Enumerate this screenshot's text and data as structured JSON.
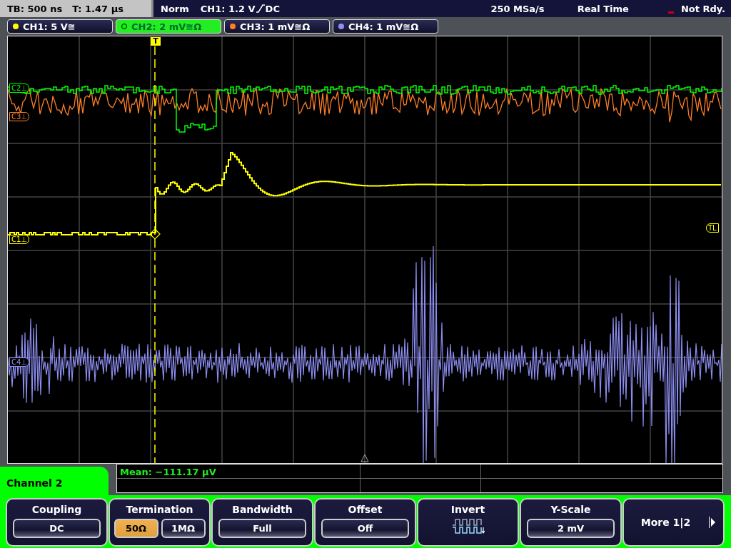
{
  "top_bar": {
    "timebase": "TB: 500 ns",
    "trigger_time": "T: 1.47 µs",
    "trigger_mode": "Norm",
    "trigger_level": "CH1: 1.2 V",
    "trigger_coupling": "DC",
    "sample_rate": "250 MSa/s",
    "acquisition": "Real Time",
    "status": "Not Rdy."
  },
  "channels": [
    {
      "label": "CH1: 5 V≅",
      "color": "#ffff00",
      "selected": false
    },
    {
      "label": "CH2: 2 mV≅Ω",
      "color": "#00ff00",
      "selected": true
    },
    {
      "label": "CH3: 1 mV≅Ω",
      "color": "#ff7f27",
      "selected": false
    },
    {
      "label": "CH4: 1 mV≅Ω",
      "color": "#9090f0",
      "selected": false
    }
  ],
  "plot": {
    "trigger_marker": "T",
    "markers": [
      {
        "label": "C2⊥",
        "color": "#00ff00",
        "kind": "left"
      },
      {
        "label": "C3⊥",
        "color": "#ff7f27",
        "kind": "left"
      },
      {
        "label": "C1⊥",
        "color": "#ffff00",
        "kind": "left"
      },
      {
        "label": "C4⊥",
        "color": "#9090f0",
        "kind": "left"
      },
      {
        "label": "TL",
        "color": "#ffff00",
        "kind": "right"
      }
    ]
  },
  "menu": {
    "title": "Channel 2",
    "measurement": "Mean: −111.17 µV",
    "softkeys": [
      {
        "kind": "single",
        "title": "Coupling",
        "value": "DC"
      },
      {
        "kind": "toggle",
        "title": "Termination",
        "options": [
          {
            "label": "50Ω",
            "selected": true
          },
          {
            "label": "1MΩ",
            "selected": false
          }
        ]
      },
      {
        "kind": "single",
        "title": "Bandwidth",
        "value": "Full"
      },
      {
        "kind": "single",
        "title": "Offset",
        "value": "Off"
      },
      {
        "kind": "icon",
        "title": "Invert"
      },
      {
        "kind": "single",
        "title": "Y-Scale",
        "value": "2 mV"
      },
      {
        "kind": "more",
        "title": "More 1|2"
      }
    ]
  }
}
